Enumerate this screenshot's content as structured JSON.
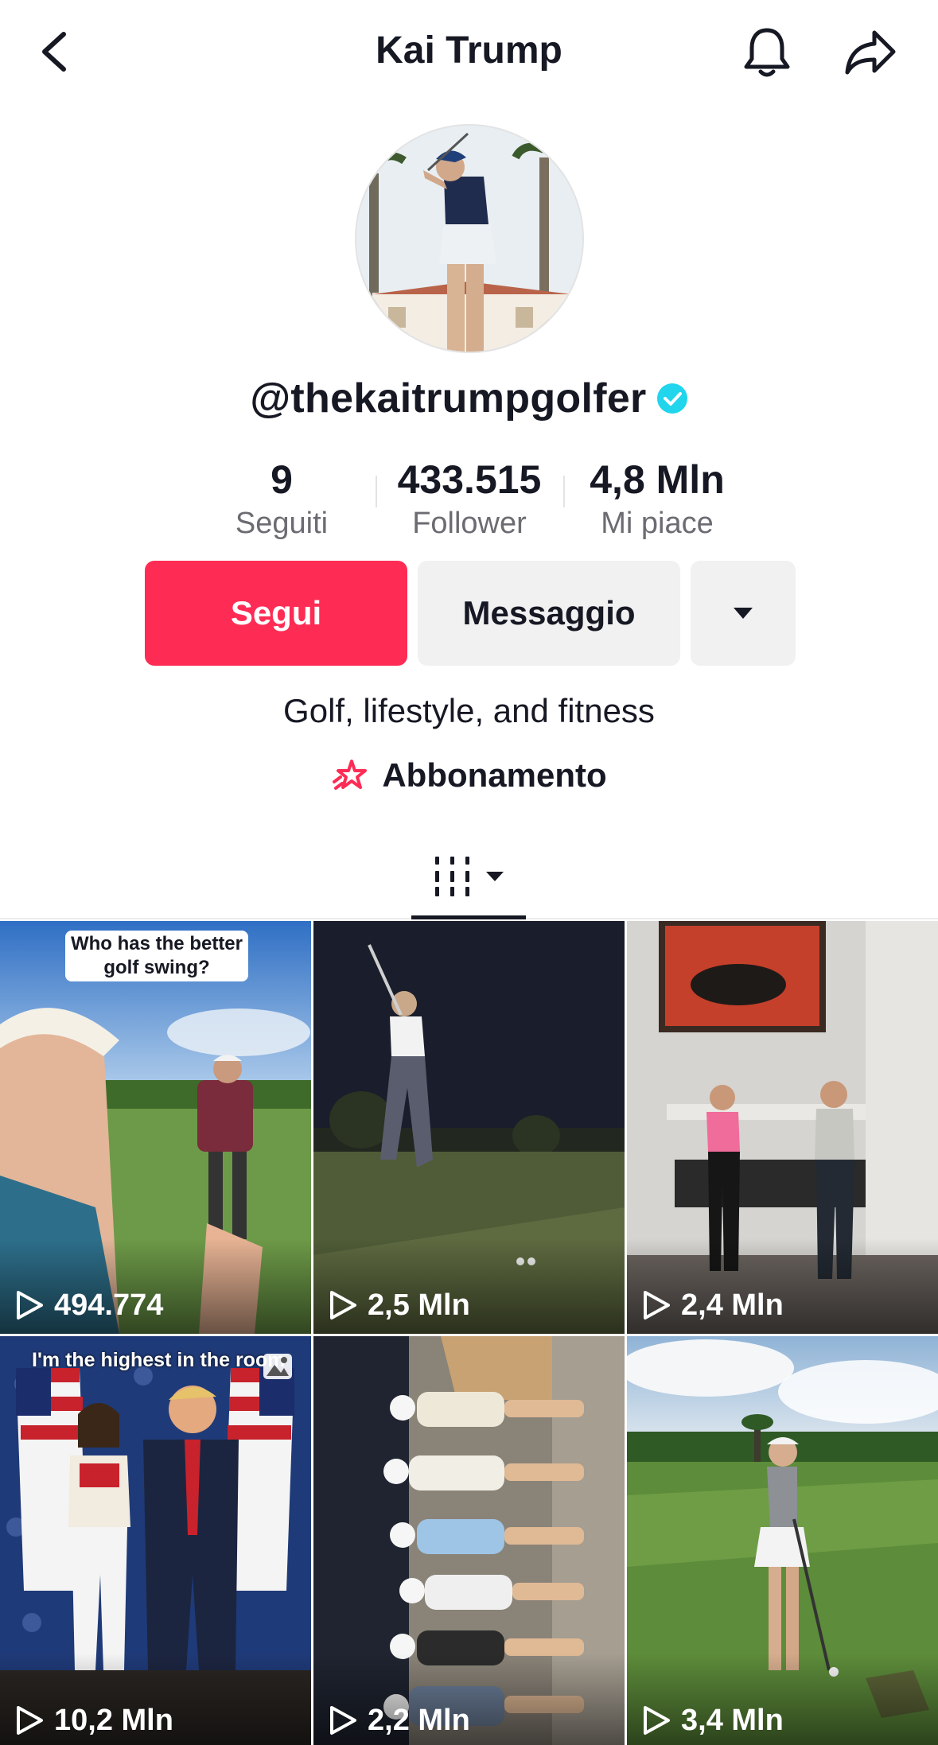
{
  "header": {
    "title": "Kai Trump",
    "back_icon": "chevron-left-icon",
    "bell_icon": "bell-icon",
    "share_icon": "share-arrow-icon"
  },
  "profile": {
    "username": "@thekaitrumpgolfer",
    "verified": true,
    "avatar_desc": "avatar"
  },
  "stats": [
    {
      "value": "9",
      "label": "Seguiti"
    },
    {
      "value": "433.515",
      "label": "Follower"
    },
    {
      "value": "4,8 Mln",
      "label": "Mi piace"
    }
  ],
  "buttons": {
    "follow": "Segui",
    "message": "Messaggio"
  },
  "bio": "Golf, lifestyle, and fitness",
  "subscription": {
    "label": "Abbonamento"
  },
  "colors": {
    "accent": "#fe2c55",
    "verified": "#20d5ec",
    "text": "#161823",
    "muted": "#6b6c72",
    "button_bg": "#f1f1f2"
  },
  "videos": [
    {
      "views": "494.774",
      "caption": "Who has the better golf swing?"
    },
    {
      "views": "2,5 Mln"
    },
    {
      "views": "2,4 Mln"
    },
    {
      "views": "10,2 Mln",
      "caption": "I'm the highest in the room",
      "photo_post": true
    },
    {
      "views": "2,2 Mln"
    },
    {
      "views": "3,4 Mln"
    }
  ]
}
